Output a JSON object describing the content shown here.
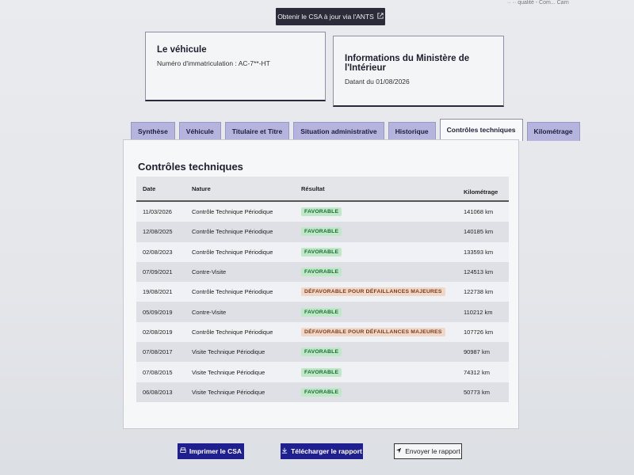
{
  "top_strip": {
    "text": "·· ·· qualité - Com...      Carn"
  },
  "csa_button": {
    "label": "Obtenir le CSA à jour via l'ANTS",
    "icon": "external-link-icon"
  },
  "vehicle_card": {
    "title": "Le véhicule",
    "plate_label": "Numéro d'immatriculation : AC-7**-HT"
  },
  "ministry_card": {
    "title": "Informations du Ministère de l'Intérieur",
    "date_label": "Datant du 01/08/2026"
  },
  "tabs": [
    {
      "label": "Synthèse",
      "active": false
    },
    {
      "label": "Véhicule",
      "active": false
    },
    {
      "label": "Titulaire et Titre",
      "active": false
    },
    {
      "label": "Situation administrative",
      "active": false
    },
    {
      "label": "Historique",
      "active": false
    },
    {
      "label": "Contrôles techniques",
      "active": true
    },
    {
      "label": "Kilométrage",
      "active": false
    }
  ],
  "section": {
    "title": "Contrôles techniques",
    "columns": [
      "Date",
      "Nature",
      "Résultat",
      "Kilométrage"
    ],
    "rows": [
      {
        "date": "11/03/2026",
        "nature": "Contrôle Technique Périodique",
        "result": "FAVORABLE",
        "status": "ok",
        "km": "141068 km"
      },
      {
        "date": "12/08/2025",
        "nature": "Contrôle Technique Périodique",
        "result": "FAVORABLE",
        "status": "ok",
        "km": "140185 km"
      },
      {
        "date": "02/08/2023",
        "nature": "Contrôle Technique Périodique",
        "result": "FAVORABLE",
        "status": "ok",
        "km": "133593 km"
      },
      {
        "date": "07/09/2021",
        "nature": "Contre-Visite",
        "result": "FAVORABLE",
        "status": "ok",
        "km": "124513 km"
      },
      {
        "date": "19/08/2021",
        "nature": "Contrôle Technique Périodique",
        "result": "DÉFAVORABLE POUR DÉFAILLANCES MAJEURES",
        "status": "ko",
        "km": "122738 km"
      },
      {
        "date": "05/09/2019",
        "nature": "Contre-Visite",
        "result": "FAVORABLE",
        "status": "ok",
        "km": "110212 km"
      },
      {
        "date": "02/08/2019",
        "nature": "Contrôle Technique Périodique",
        "result": "DÉFAVORABLE POUR DÉFAILLANCES MAJEURES",
        "status": "ko",
        "km": "107726 km"
      },
      {
        "date": "07/08/2017",
        "nature": "Visite Technique Périodique",
        "result": "FAVORABLE",
        "status": "ok",
        "km": "90987 km"
      },
      {
        "date": "07/08/2015",
        "nature": "Visite Technique Périodique",
        "result": "FAVORABLE",
        "status": "ok",
        "km": "74312 km"
      },
      {
        "date": "06/08/2013",
        "nature": "Visite Technique Périodique",
        "result": "FAVORABLE",
        "status": "ok",
        "km": "50773 km"
      }
    ]
  },
  "actions": {
    "print_label": "Imprimer le CSA",
    "download_label": "Télécharger le rapport",
    "send_label": "Envoyer le rapport"
  },
  "colors": {
    "primary": "#1f1f8f",
    "tab_bg": "#b5b4de",
    "favorable": "#bfe8c9",
    "defavorable": "#f1d7c8"
  }
}
